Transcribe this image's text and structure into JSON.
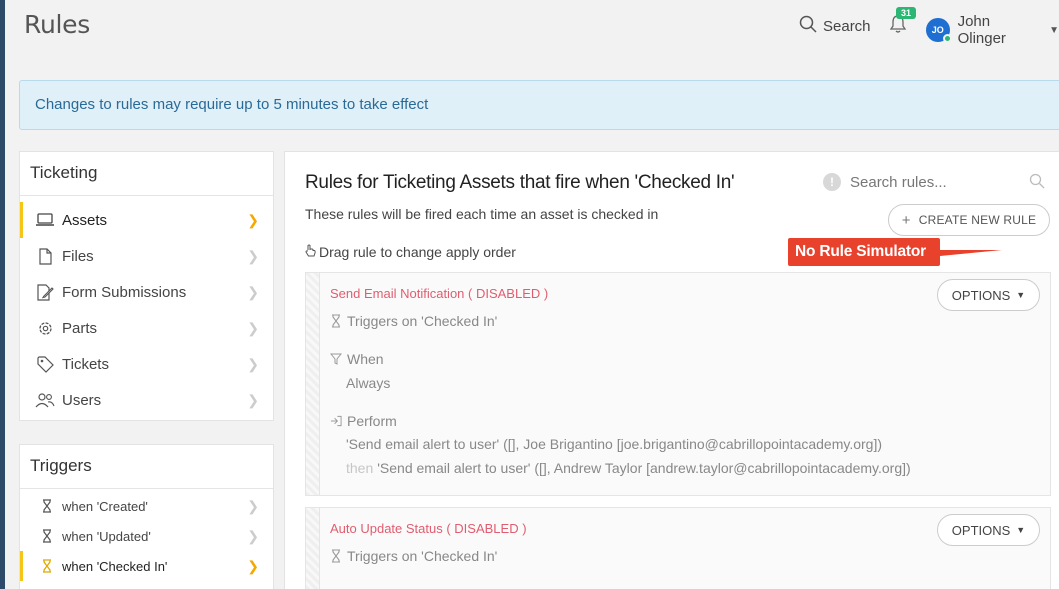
{
  "header": {
    "title": "Rules",
    "search_label": "Search",
    "notifications_count": "31",
    "user_initials": "JO",
    "user_name": "John Olinger"
  },
  "notice": "Changes to rules may require up to 5 minutes to take effect",
  "sidebar": {
    "section_title": "Ticketing",
    "items": [
      {
        "label": "Assets",
        "icon": "laptop-icon",
        "active": true
      },
      {
        "label": "Files",
        "icon": "file-icon",
        "active": false
      },
      {
        "label": "Form Submissions",
        "icon": "form-icon",
        "active": false
      },
      {
        "label": "Parts",
        "icon": "gear-icon",
        "active": false
      },
      {
        "label": "Tickets",
        "icon": "tag-icon",
        "active": false
      },
      {
        "label": "Users",
        "icon": "users-icon",
        "active": false
      }
    ]
  },
  "triggers": {
    "section_title": "Triggers",
    "items": [
      {
        "label": "when 'Created'",
        "icon": "hourglass-icon",
        "active": false
      },
      {
        "label": "when 'Updated'",
        "icon": "hourglass-icon",
        "active": false
      },
      {
        "label": "when 'Checked In'",
        "icon": "hourglass-icon",
        "active": true
      }
    ]
  },
  "main": {
    "title": "Rules for Ticketing Assets that fire when 'Checked In'",
    "subtitle": "These rules will be fired each time an asset is checked in",
    "search_placeholder": "Search rules...",
    "create_button": "CREATE NEW RULE",
    "drag_hint": "Drag rule to change apply order",
    "callout_text": "No Rule Simulator"
  },
  "rules": [
    {
      "title": "Send Email Notification ( DISABLED )",
      "options_label": "OPTIONS",
      "trigger": "Triggers on 'Checked In'",
      "when_label": "When",
      "when_value": "Always",
      "perform_label": "Perform",
      "actions": [
        "'Send email alert to user' ([], Joe Brigantino [joe.brigantino@cabrillopointacademy.org])",
        "'Send email alert to user' ([], Andrew Taylor [andrew.taylor@cabrillopointacademy.org])"
      ],
      "then_label": "then"
    },
    {
      "title": "Auto Update Status ( DISABLED )",
      "options_label": "OPTIONS",
      "trigger": "Triggers on 'Checked In'"
    }
  ],
  "colors": {
    "accent": "#f5c518",
    "disabled_title": "#e05d6f",
    "callout": "#e8412c",
    "notice_bg": "#e0f0f9",
    "badge": "#2bb673"
  }
}
